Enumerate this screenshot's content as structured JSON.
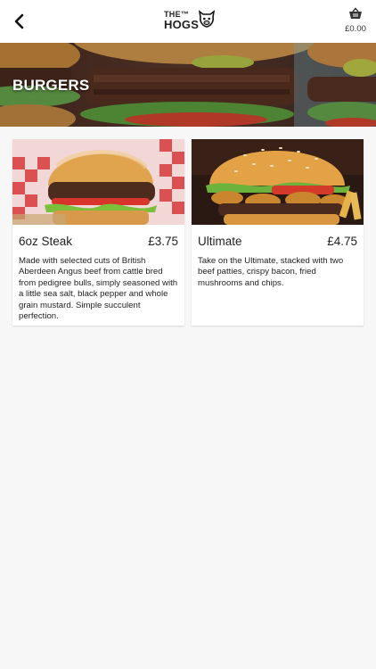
{
  "header": {
    "logo_line1": "THE™",
    "logo_line2": "HOGS",
    "basket_amount": "£0.00"
  },
  "category": {
    "title": "BURGERS"
  },
  "products": [
    {
      "name": "6oz Steak",
      "price": "£3.75",
      "description": "Made with selected cuts of British Aberdeen Angus beef from cattle bred from pedigree bulls, simply seasoned with a little sea salt, black pepper and whole grain mustard. Simple succulent perfection."
    },
    {
      "name": "Ultimate",
      "price": "£4.75",
      "description": "Take on the Ultimate, stacked with two beef patties, crispy bacon, fried mushrooms and chips."
    }
  ]
}
